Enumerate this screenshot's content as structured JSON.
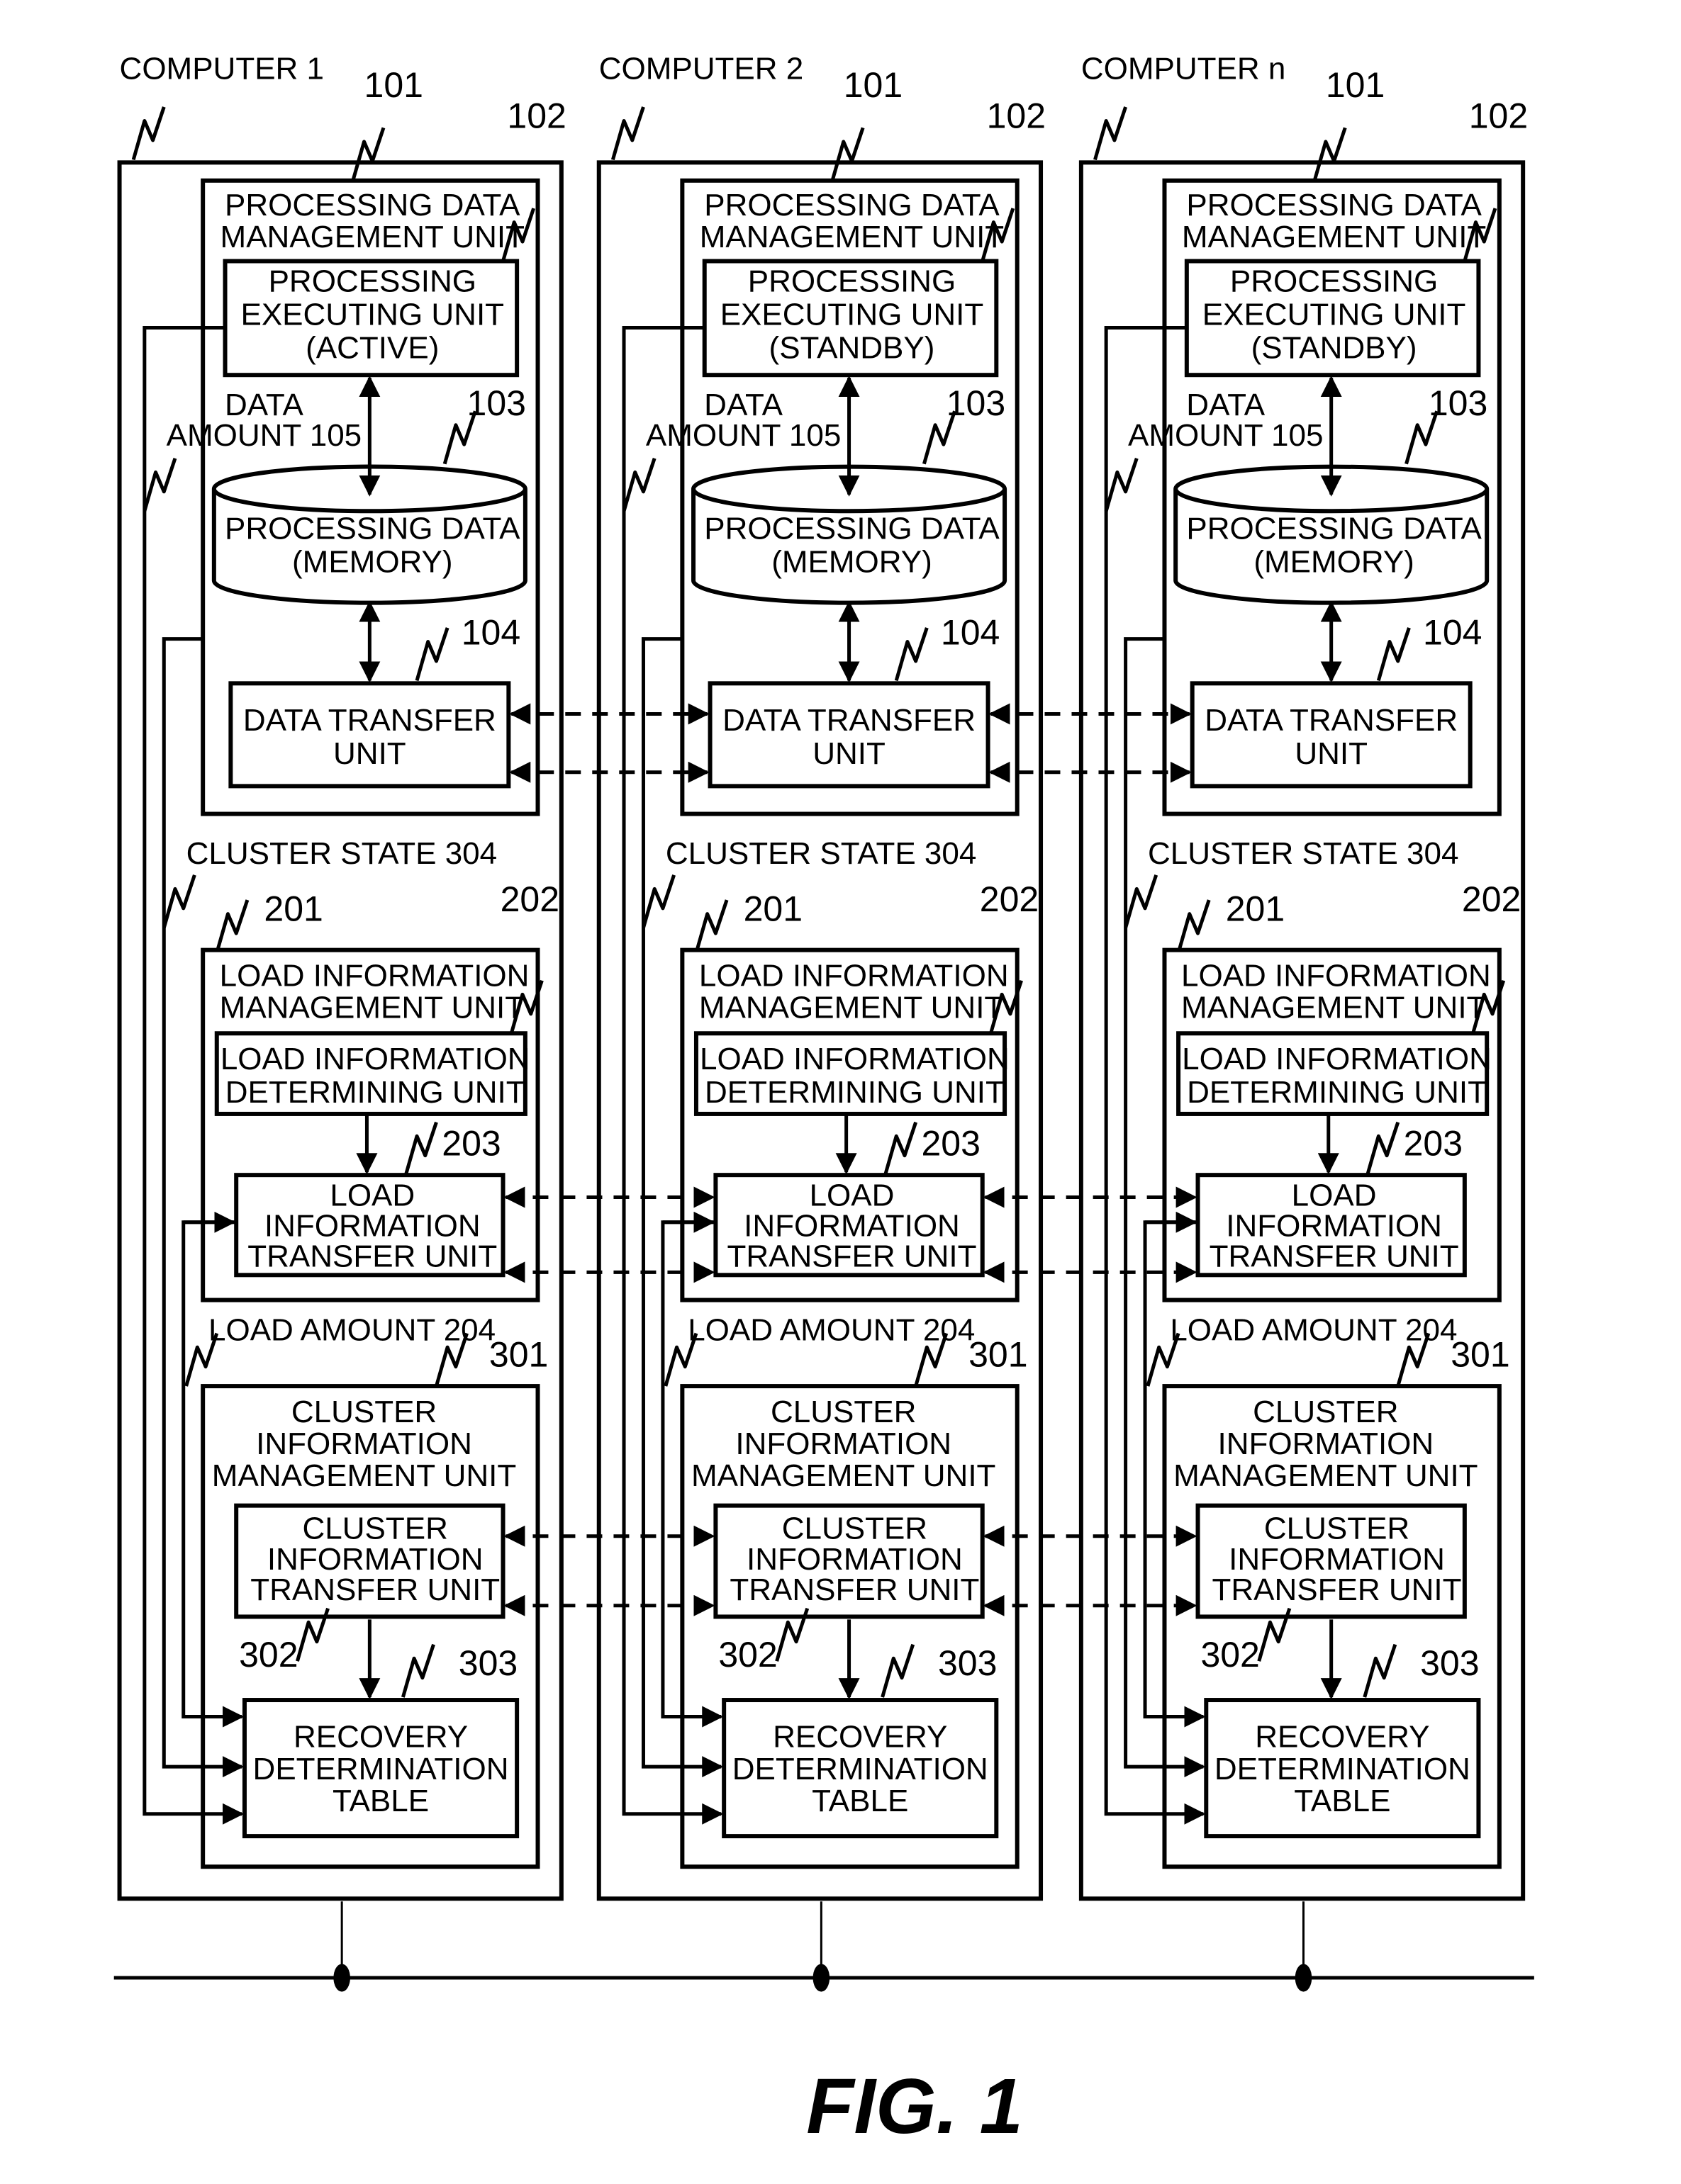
{
  "figure_label": "FIG. 1",
  "computers": [
    {
      "name": "COMPUTER 1",
      "processing_data_management_unit": {
        "ref": "101",
        "label": [
          "PROCESSING DATA",
          "MANAGEMENT UNIT"
        ]
      },
      "processing_executing_unit": {
        "ref": "102",
        "label": [
          "PROCESSING",
          "EXECUTING UNIT",
          "(ACTIVE)"
        ]
      },
      "processing_data": {
        "ref": "103",
        "label": [
          "PROCESSING DATA",
          "(MEMORY)"
        ]
      },
      "data_transfer_unit": {
        "ref": "104",
        "label": [
          "DATA TRANSFER",
          "UNIT"
        ]
      },
      "data_amount": {
        "label": [
          "DATA",
          "AMOUNT 105"
        ]
      },
      "cluster_state": {
        "label": "CLUSTER STATE 304"
      },
      "load_information_management_unit": {
        "ref": "201",
        "label": [
          "LOAD INFORMATION",
          "MANAGEMENT UNIT"
        ]
      },
      "load_information_determining_unit": {
        "ref": "202",
        "label": [
          "LOAD INFORMATION",
          "DETERMINING UNIT"
        ]
      },
      "load_information_transfer_unit": {
        "ref": "203",
        "label": [
          "LOAD",
          "INFORMATION",
          "TRANSFER UNIT"
        ]
      },
      "load_amount": {
        "label": "LOAD AMOUNT 204"
      },
      "cluster_information_management_unit": {
        "ref": "301",
        "label": [
          "CLUSTER",
          "INFORMATION",
          "MANAGEMENT UNIT"
        ]
      },
      "cluster_information_transfer_unit": {
        "ref": "302",
        "label": [
          "CLUSTER",
          "INFORMATION",
          "TRANSFER UNIT"
        ]
      },
      "recovery_determination_table": {
        "ref": "303",
        "label": [
          "RECOVERY",
          "DETERMINATION",
          "TABLE"
        ]
      }
    },
    {
      "name": "COMPUTER 2",
      "processing_data_management_unit": {
        "ref": "101",
        "label": [
          "PROCESSING DATA",
          "MANAGEMENT UNIT"
        ]
      },
      "processing_executing_unit": {
        "ref": "102",
        "label": [
          "PROCESSING",
          "EXECUTING UNIT",
          "(STANDBY)"
        ]
      },
      "processing_data": {
        "ref": "103",
        "label": [
          "PROCESSING DATA",
          "(MEMORY)"
        ]
      },
      "data_transfer_unit": {
        "ref": "104",
        "label": [
          "DATA TRANSFER",
          "UNIT"
        ]
      },
      "data_amount": {
        "label": [
          "DATA",
          "AMOUNT 105"
        ]
      },
      "cluster_state": {
        "label": "CLUSTER STATE 304"
      },
      "load_information_management_unit": {
        "ref": "201",
        "label": [
          "LOAD INFORMATION",
          "MANAGEMENT UNIT"
        ]
      },
      "load_information_determining_unit": {
        "ref": "202",
        "label": [
          "LOAD INFORMATION",
          "DETERMINING UNIT"
        ]
      },
      "load_information_transfer_unit": {
        "ref": "203",
        "label": [
          "LOAD",
          "INFORMATION",
          "TRANSFER UNIT"
        ]
      },
      "load_amount": {
        "label": "LOAD AMOUNT 204"
      },
      "cluster_information_management_unit": {
        "ref": "301",
        "label": [
          "CLUSTER",
          "INFORMATION",
          "MANAGEMENT UNIT"
        ]
      },
      "cluster_information_transfer_unit": {
        "ref": "302",
        "label": [
          "CLUSTER",
          "INFORMATION",
          "TRANSFER UNIT"
        ]
      },
      "recovery_determination_table": {
        "ref": "303",
        "label": [
          "RECOVERY",
          "DETERMINATION",
          "TABLE"
        ]
      }
    },
    {
      "name": "COMPUTER n",
      "processing_data_management_unit": {
        "ref": "101",
        "label": [
          "PROCESSING DATA",
          "MANAGEMENT UNIT"
        ]
      },
      "processing_executing_unit": {
        "ref": "102",
        "label": [
          "PROCESSING",
          "EXECUTING UNIT",
          "(STANDBY)"
        ]
      },
      "processing_data": {
        "ref": "103",
        "label": [
          "PROCESSING DATA",
          "(MEMORY)"
        ]
      },
      "data_transfer_unit": {
        "ref": "104",
        "label": [
          "DATA TRANSFER",
          "UNIT"
        ]
      },
      "data_amount": {
        "label": [
          "DATA",
          "AMOUNT 105"
        ]
      },
      "cluster_state": {
        "label": "CLUSTER STATE 304"
      },
      "load_information_management_unit": {
        "ref": "201",
        "label": [
          "LOAD INFORMATION",
          "MANAGEMENT UNIT"
        ]
      },
      "load_information_determining_unit": {
        "ref": "202",
        "label": [
          "LOAD INFORMATION",
          "DETERMINING UNIT"
        ]
      },
      "load_information_transfer_unit": {
        "ref": "203",
        "label": [
          "LOAD",
          "INFORMATION",
          "TRANSFER UNIT"
        ]
      },
      "load_amount": {
        "label": "LOAD AMOUNT 204"
      },
      "cluster_information_management_unit": {
        "ref": "301",
        "label": [
          "CLUSTER",
          "INFORMATION",
          "MANAGEMENT UNIT"
        ]
      },
      "cluster_information_transfer_unit": {
        "ref": "302",
        "label": [
          "CLUSTER",
          "INFORMATION",
          "TRANSFER UNIT"
        ]
      },
      "recovery_determination_table": {
        "ref": "303",
        "label": [
          "RECOVERY",
          "DETERMINATION",
          "TABLE"
        ]
      }
    }
  ]
}
